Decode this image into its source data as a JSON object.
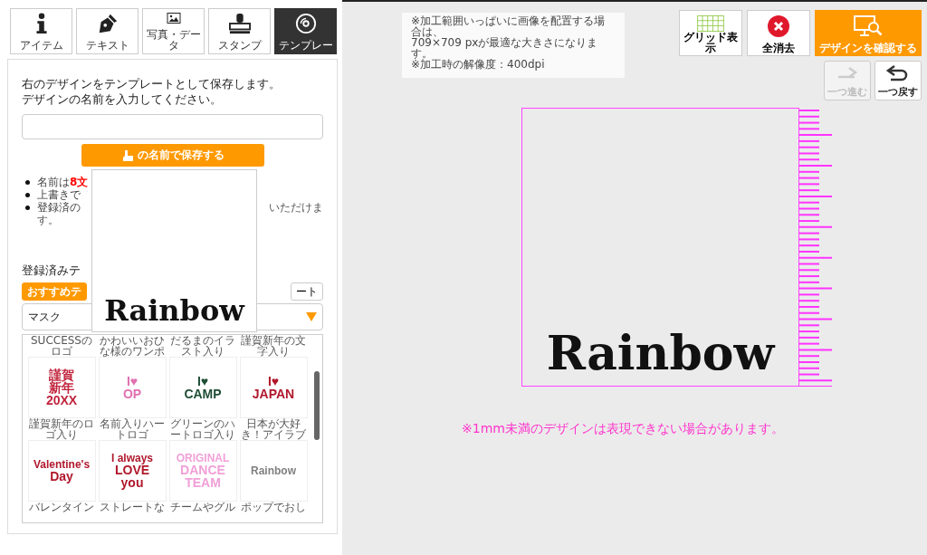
{
  "tools": [
    {
      "kind": "info",
      "label": "アイテム",
      "selected": false
    },
    {
      "kind": "pen",
      "label": "テキスト",
      "selected": false
    },
    {
      "kind": "image",
      "label": "写真・データ",
      "selected": false
    },
    {
      "kind": "stamp",
      "label": "スタンプ",
      "selected": false
    },
    {
      "kind": "disc",
      "label": "テンプレー",
      "selected": true
    }
  ],
  "save_panel": {
    "intro": [
      "右のデザインをテンプレートとして保存します。",
      "デザインの名前を入力してください。"
    ],
    "save_button": "の名前で保存する",
    "notes": [
      {
        "left": "名前は**8文**"
      },
      {
        "left": "上書きで"
      },
      {
        "left": "登録済の",
        "right": "いただけま",
        "tail": "す。"
      }
    ]
  },
  "registered": {
    "heading": "登録済みテ",
    "tabs": [
      {
        "label": "おすすめテ",
        "selected": true
      },
      {
        "label": "ート",
        "selected": false
      }
    ],
    "category_select": {
      "value": "マスク"
    },
    "top_captions": [
      "SUCCESSのロゴ",
      "かわいいおひな様のワンポ",
      "だるまのイラスト入り",
      "謹賀新年の文字入り"
    ],
    "templates": [
      {
        "art": [
          "謹賀",
          "新年",
          "20XX"
        ],
        "color": "#c0243c",
        "caption": "謹賀新年のロゴ入り"
      },
      {
        "art": [
          "I♥",
          "OP"
        ],
        "color": "#e070b0",
        "caption": "名前入りハートロゴ"
      },
      {
        "art": [
          "I♥",
          "CAMP"
        ],
        "color": "#1f4d35",
        "caption": "グリーンのハートロゴ入り"
      },
      {
        "art": [
          "I♥",
          "JAPAN"
        ],
        "color": "#b0182c",
        "caption": "日本が大好き！アイラブ"
      },
      {
        "art": [
          "Valentine's",
          "Day"
        ],
        "color": "#b0182c",
        "caption": "バレンタイン"
      },
      {
        "art": [
          "I always",
          "LOVE",
          "you"
        ],
        "color": "#b0182c",
        "caption": "ストレートな"
      },
      {
        "art": [
          "ORIGINAL",
          "DANCE",
          "TEAM"
        ],
        "color": "#f0a0d8",
        "caption": "チームやグル"
      },
      {
        "art": [
          "Rainbow"
        ],
        "color": "#808080",
        "caption": "ポップでおし"
      }
    ]
  },
  "hover_preview": {
    "logo": "Rainbow"
  },
  "info": [
    "※加工範囲いっぱいに画像を配置する場合は、",
    "709×709 pxが最適な大きさになります。",
    "※加工時の解像度：400dpi"
  ],
  "toolbar": [
    {
      "kind": "grid",
      "label": "グリッド表示",
      "primary": false
    },
    {
      "kind": "clear",
      "label": "全消去",
      "primary": false
    },
    {
      "kind": "monitor",
      "label": "デザインを確認する",
      "primary": true
    }
  ],
  "history": [
    {
      "kind": "redo",
      "label": "一つ進む",
      "disabled": true
    },
    {
      "kind": "undo",
      "label": "一つ戻す",
      "disabled": false
    }
  ],
  "design": {
    "logo": "Rainbow"
  },
  "warning": "※1mm未満のデザインは表現できない場合があります。"
}
